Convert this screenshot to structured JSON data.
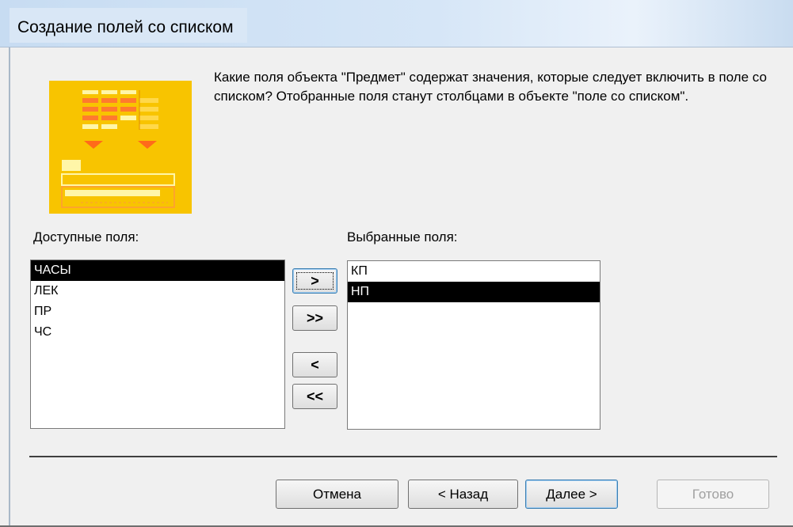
{
  "window": {
    "title": "Создание полей со списком"
  },
  "description": "Какие поля объекта \"Предмет\" содержат значения, которые следует включить в поле со списком? Отобранные поля станут столбцами в объекте \"поле со списком\".",
  "available": {
    "label": "Доступные поля:",
    "items": [
      "ЧАСЫ",
      "ЛЕК",
      "ПР",
      "ЧС"
    ],
    "selected_index": 0
  },
  "selected": {
    "label": "Выбранные поля:",
    "items": [
      "КП",
      "НП"
    ],
    "selected_index": 1
  },
  "move_buttons": {
    "add_one": ">",
    "add_all": ">>",
    "remove_one": "<",
    "remove_all": "<<"
  },
  "footer": {
    "cancel": "Отмена",
    "back": "< Назад",
    "next": "Далее >",
    "finish": "Готово"
  },
  "colors": {
    "wizard_art": "#f8c400",
    "selection": "#000000"
  }
}
